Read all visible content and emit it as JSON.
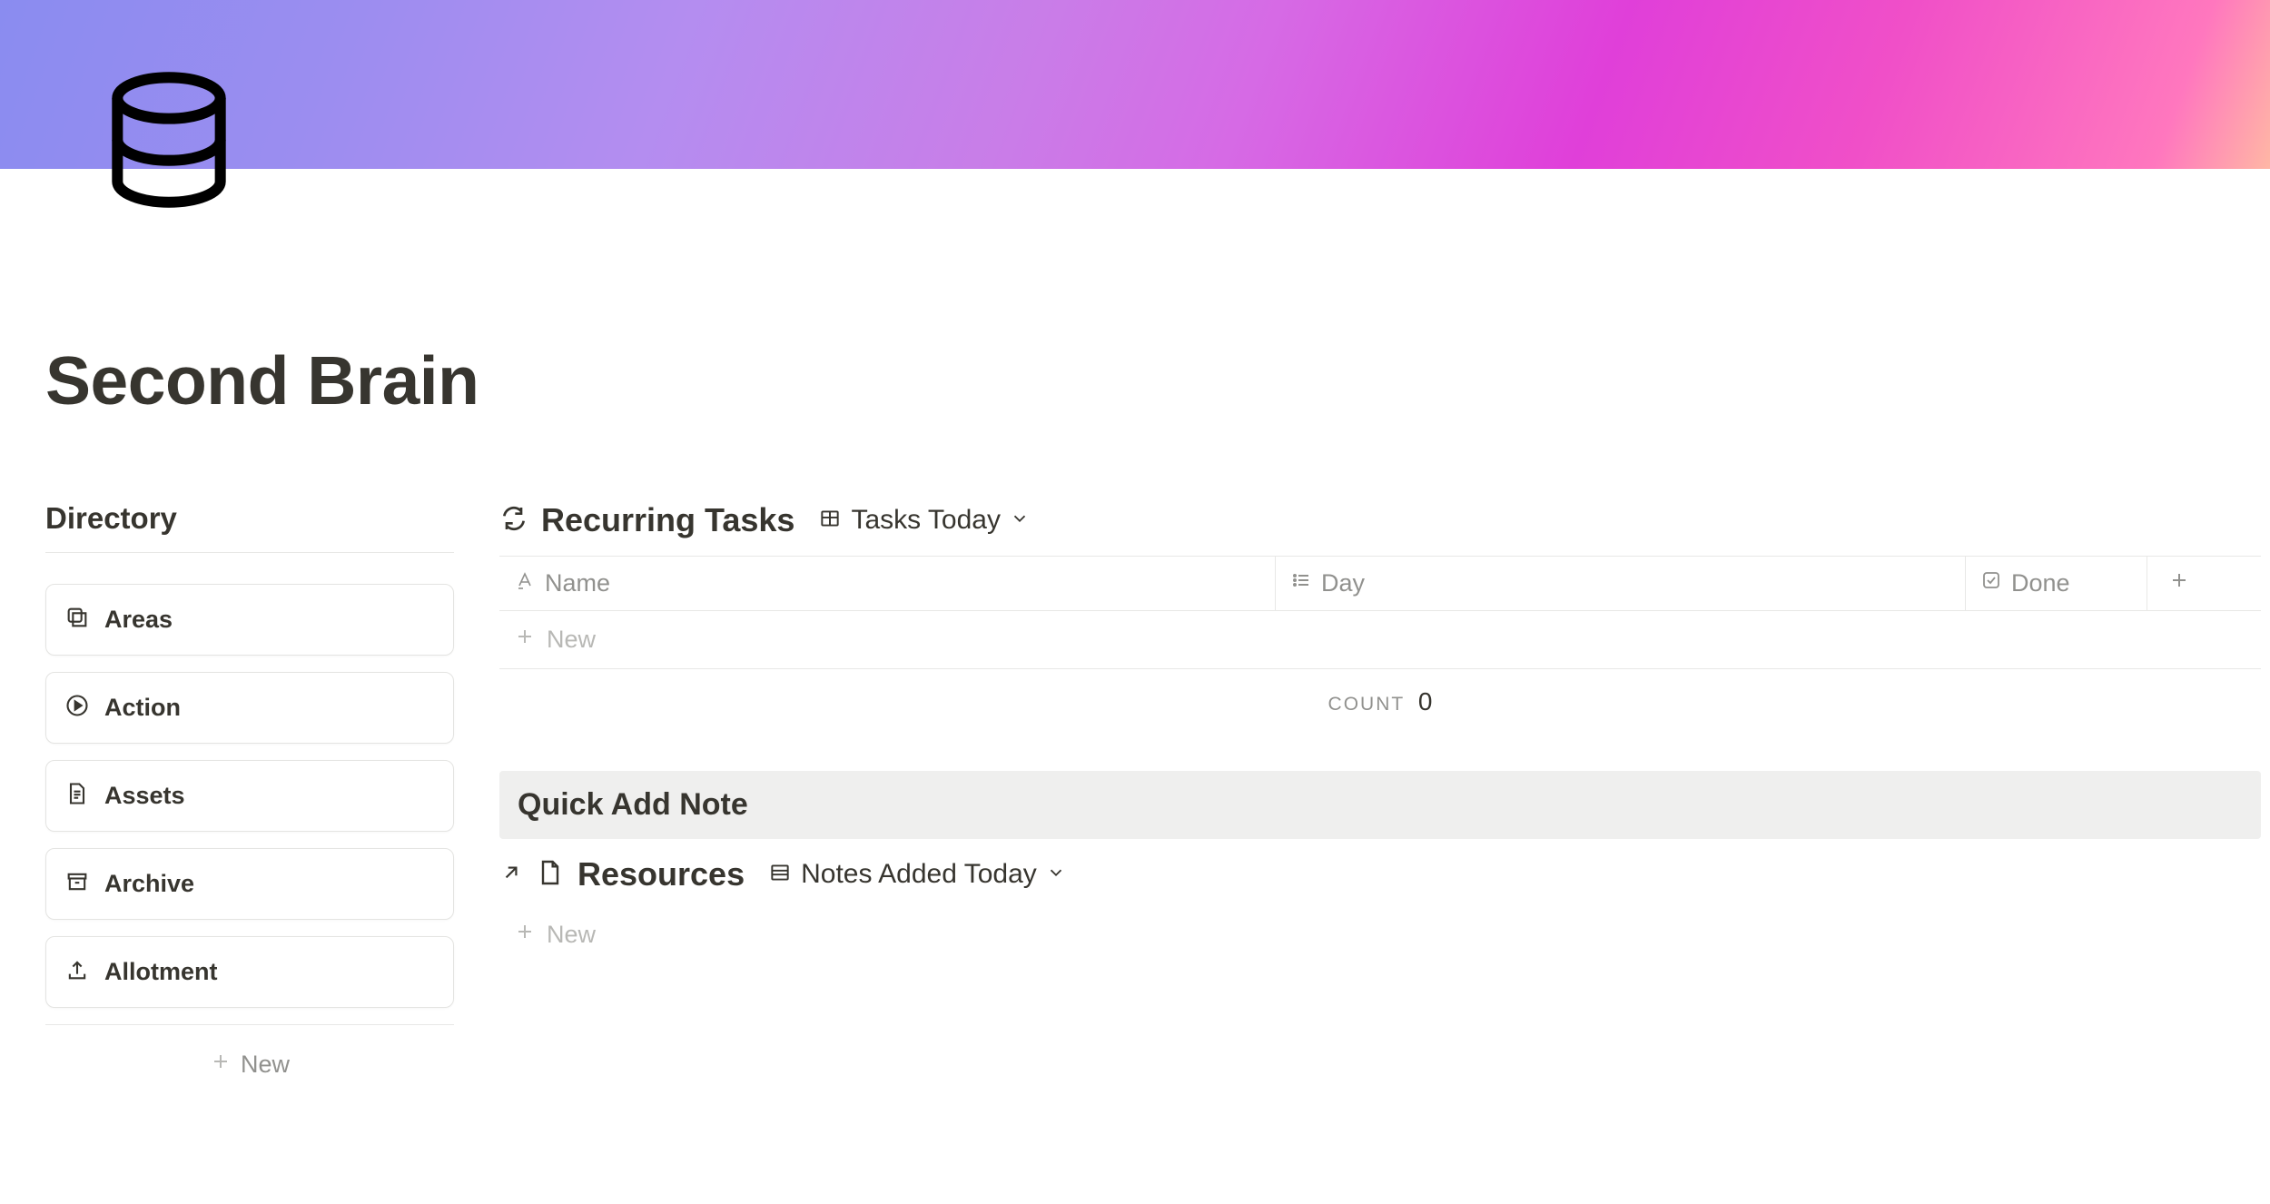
{
  "page": {
    "title": "Second Brain"
  },
  "directory": {
    "heading": "Directory",
    "items": [
      {
        "label": "Areas",
        "icon": "stack"
      },
      {
        "label": "Action",
        "icon": "play"
      },
      {
        "label": "Assets",
        "icon": "document"
      },
      {
        "label": "Archive",
        "icon": "archive"
      },
      {
        "label": "Allotment",
        "icon": "upload"
      }
    ],
    "new_label": "New"
  },
  "recurring": {
    "title": "Recurring Tasks",
    "view_label": "Tasks Today",
    "columns": {
      "name": "Name",
      "day": "Day",
      "done": "Done"
    },
    "new_row_label": "New",
    "count_label": "COUNT",
    "count_value": "0"
  },
  "quick_add": {
    "title": "Quick Add Note"
  },
  "resources": {
    "title": "Resources",
    "view_label": "Notes Added Today",
    "new_row_label": "New"
  }
}
